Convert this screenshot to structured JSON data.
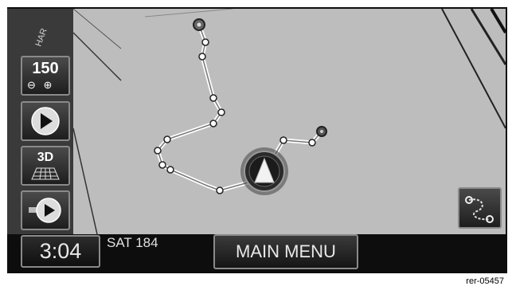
{
  "map": {
    "street_label": "HAR",
    "zoom_label": "150"
  },
  "buttons": {
    "view_3d": "3D",
    "main_menu": "MAIN MENU"
  },
  "status": {
    "time": "3:04",
    "sat_channel": "SAT 184"
  },
  "figure_ref": "rer-05457",
  "icons": [
    "zoom-out-icon",
    "zoom-in-icon",
    "play-icon",
    "3d-grid-icon",
    "demo-route-icon",
    "route-icon",
    "vehicle-arrow-icon",
    "destination-icon",
    "start-icon"
  ]
}
